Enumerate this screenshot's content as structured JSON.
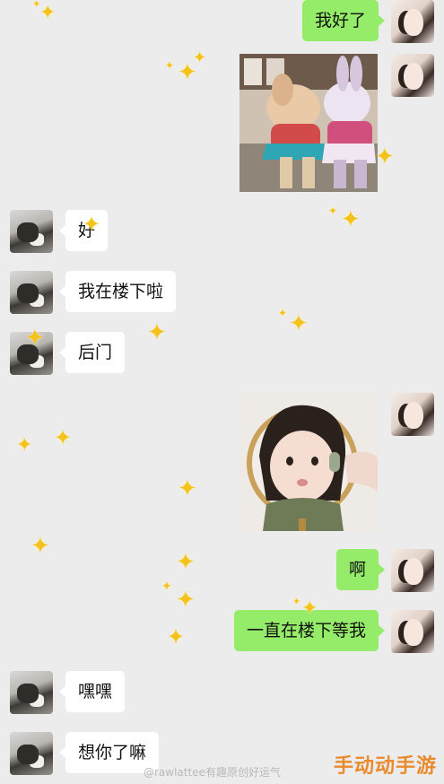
{
  "messages": [
    {
      "side": "me",
      "type": "text",
      "text": "我好了"
    },
    {
      "side": "me",
      "type": "image",
      "image": "plush-toys-photo"
    },
    {
      "side": "them",
      "type": "text",
      "text": "好"
    },
    {
      "side": "them",
      "type": "text",
      "text": "我在楼下啦"
    },
    {
      "side": "them",
      "type": "text",
      "text": "后门"
    },
    {
      "side": "me",
      "type": "image",
      "image": "girl-mirror-photo"
    },
    {
      "side": "me",
      "type": "text",
      "text": "啊"
    },
    {
      "side": "me",
      "type": "text",
      "text": "一直在楼下等我"
    },
    {
      "side": "them",
      "type": "text",
      "text": "嘿嘿"
    },
    {
      "side": "them",
      "type": "text",
      "text": "想你了嘛"
    }
  ],
  "watermark": "@rawlattee有趣原创好运气",
  "brand": "手动动手游",
  "colors": {
    "me_bubble": "#95ec69",
    "them_bubble": "#ffffff",
    "background": "#ececec",
    "sparkle": "#f4c21a"
  }
}
